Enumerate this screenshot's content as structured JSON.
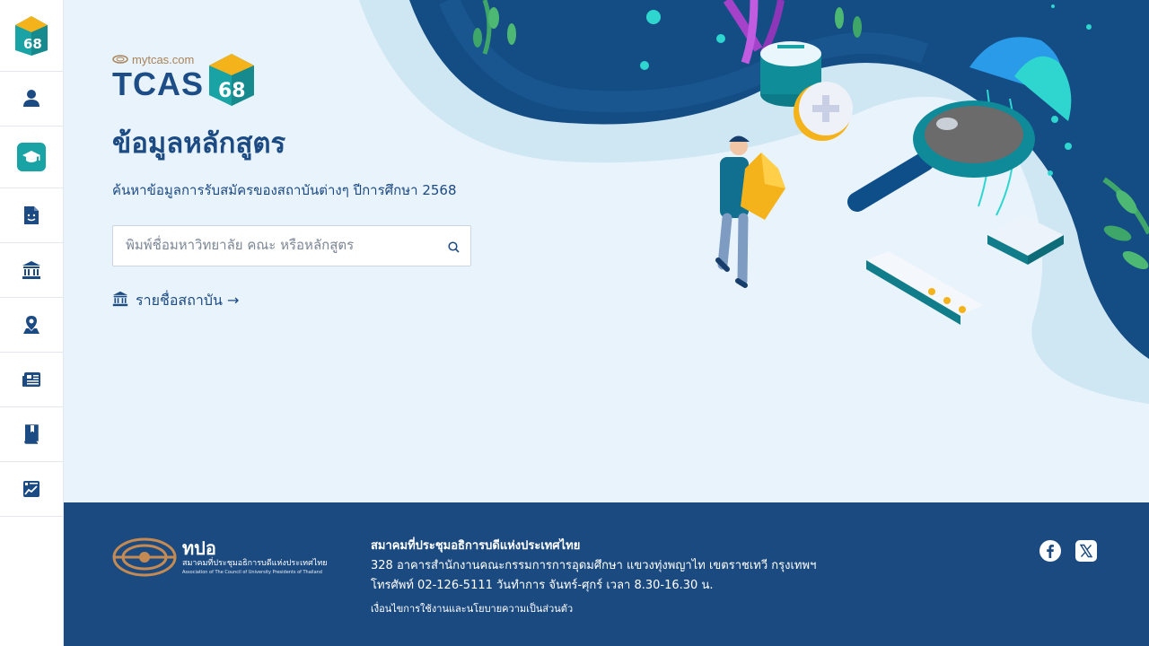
{
  "sidebar": {
    "logo_text": "68",
    "items": [
      {
        "name": "user-icon"
      },
      {
        "name": "graduation-cap-icon",
        "active": true
      },
      {
        "name": "document-face-icon"
      },
      {
        "name": "institution-icon"
      },
      {
        "name": "location-person-icon"
      },
      {
        "name": "news-icon"
      },
      {
        "name": "book-bookmark-icon"
      },
      {
        "name": "chart-icon"
      }
    ]
  },
  "brand": {
    "site": "mytcas.com",
    "name": "TCAS",
    "year": "68"
  },
  "page": {
    "title": "ข้อมูลหลักสูตร",
    "subtitle": "ค้นหาข้อมูลการรับสมัครของสถาบันต่างๆ ปีการศึกษา 2568"
  },
  "search": {
    "placeholder": "พิมพ์ชื่อมหาวิทยาลัย คณะ หรือหลักสูตร",
    "value": ""
  },
  "institution_link": {
    "label": "รายชื่อสถาบัน →"
  },
  "footer": {
    "org_abbr": "ทปอ",
    "org_full": "สมาคมที่ประชุมอธิการบดีแห่งประเทศไทย",
    "org_english": "Association of The Council of University Presidents of Thailand",
    "org_name": "สมาคมที่ประชุมอธิการบดีแห่งประเทศไทย",
    "address": "328 อาคารสำนักงานคณะกรรมการการอุดมศึกษา แขวงทุ่งพญาไท เขตราชเทวี กรุงเทพฯ",
    "phone": "โทรศัพท์ 02-126-5111 วันทำการ จันทร์-ศุกร์ เวลา 8.30-16.30 น.",
    "terms": "เงื่อนไขการใช้งานและนโยบายความเป็นส่วนตัว",
    "social": [
      "facebook-icon",
      "x-icon"
    ]
  },
  "colors": {
    "primary": "#1c4a83",
    "accent": "#1aa3a5",
    "background": "#e9f3fc",
    "footer": "#1b4a80",
    "brand_gold": "#f5b31b"
  }
}
